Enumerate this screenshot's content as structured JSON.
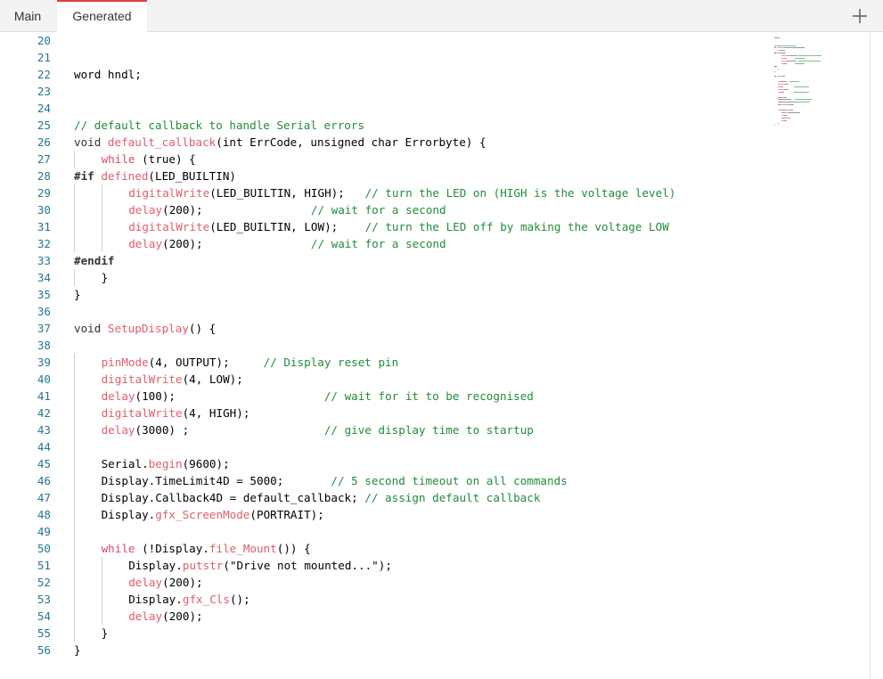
{
  "tabs": [
    {
      "label": "Main"
    },
    {
      "label": "Generated"
    }
  ],
  "add_tab_icon": "plus-icon",
  "colors": {
    "comment": "#218c3a",
    "function": "#e15d6b",
    "line_number": "#237893",
    "active_tab_accent": "#e04040"
  },
  "editor": {
    "lines": [
      {
        "n": "20",
        "indent": 0,
        "tokens": []
      },
      {
        "n": "21",
        "indent": 0,
        "tokens": []
      },
      {
        "n": "22",
        "indent": 0,
        "tokens": [
          {
            "t": "word hndl;",
            "c": ""
          }
        ]
      },
      {
        "n": "23",
        "indent": 0,
        "tokens": []
      },
      {
        "n": "24",
        "indent": 0,
        "tokens": []
      },
      {
        "n": "25",
        "indent": 0,
        "tokens": [
          {
            "t": "// default callback to handle Serial errors",
            "c": "cm"
          }
        ]
      },
      {
        "n": "26",
        "indent": 0,
        "tokens": [
          {
            "t": "void ",
            "c": "kw"
          },
          {
            "t": "default_callback",
            "c": "fn"
          },
          {
            "t": "(int ErrCode, unsigned char Errorbyte) {",
            "c": ""
          }
        ]
      },
      {
        "n": "27",
        "indent": 1,
        "tokens": [
          {
            "t": "while",
            "c": "ctrl"
          },
          {
            "t": " (true) {",
            "c": ""
          }
        ]
      },
      {
        "n": "28",
        "indent": 0,
        "tokens": [
          {
            "t": "#if",
            "c": "pp"
          },
          {
            "t": " ",
            "c": ""
          },
          {
            "t": "defined",
            "c": "fn"
          },
          {
            "t": "(LED_BUILTIN)",
            "c": ""
          }
        ]
      },
      {
        "n": "29",
        "indent": 2,
        "tokens": [
          {
            "t": "digitalWrite",
            "c": "fn"
          },
          {
            "t": "(LED_BUILTIN, HIGH);   ",
            "c": ""
          },
          {
            "t": "// turn the LED on (HIGH is the voltage level)",
            "c": "cm"
          }
        ]
      },
      {
        "n": "30",
        "indent": 2,
        "tokens": [
          {
            "t": "delay",
            "c": "fn"
          },
          {
            "t": "(200);                ",
            "c": ""
          },
          {
            "t": "// wait for a second",
            "c": "cm"
          }
        ]
      },
      {
        "n": "31",
        "indent": 2,
        "tokens": [
          {
            "t": "digitalWrite",
            "c": "fn"
          },
          {
            "t": "(LED_BUILTIN, LOW);    ",
            "c": ""
          },
          {
            "t": "// turn the LED off by making the voltage LOW",
            "c": "cm"
          }
        ]
      },
      {
        "n": "32",
        "indent": 2,
        "tokens": [
          {
            "t": "delay",
            "c": "fn"
          },
          {
            "t": "(200);                ",
            "c": ""
          },
          {
            "t": "// wait for a second",
            "c": "cm"
          }
        ]
      },
      {
        "n": "33",
        "indent": 0,
        "tokens": [
          {
            "t": "#endif",
            "c": "pp"
          }
        ]
      },
      {
        "n": "34",
        "indent": 1,
        "tokens": [
          {
            "t": "}",
            "c": ""
          }
        ]
      },
      {
        "n": "35",
        "indent": 0,
        "tokens": [
          {
            "t": "}",
            "c": ""
          }
        ]
      },
      {
        "n": "36",
        "indent": 0,
        "tokens": []
      },
      {
        "n": "37",
        "indent": 0,
        "tokens": [
          {
            "t": "void ",
            "c": "kw"
          },
          {
            "t": "SetupDisplay",
            "c": "fn"
          },
          {
            "t": "() {",
            "c": ""
          }
        ]
      },
      {
        "n": "38",
        "indent": 0,
        "tokens": []
      },
      {
        "n": "39",
        "indent": 1,
        "tokens": [
          {
            "t": "pinMode",
            "c": "fn"
          },
          {
            "t": "(4, OUTPUT);     ",
            "c": ""
          },
          {
            "t": "// Display reset pin",
            "c": "cm"
          }
        ]
      },
      {
        "n": "40",
        "indent": 1,
        "tokens": [
          {
            "t": "digitalWrite",
            "c": "fn"
          },
          {
            "t": "(4, LOW);",
            "c": ""
          }
        ]
      },
      {
        "n": "41",
        "indent": 1,
        "tokens": [
          {
            "t": "delay",
            "c": "fn"
          },
          {
            "t": "(100);                      ",
            "c": ""
          },
          {
            "t": "// wait for it to be recognised",
            "c": "cm"
          }
        ]
      },
      {
        "n": "42",
        "indent": 1,
        "tokens": [
          {
            "t": "digitalWrite",
            "c": "fn"
          },
          {
            "t": "(4, HIGH);",
            "c": ""
          }
        ]
      },
      {
        "n": "43",
        "indent": 1,
        "tokens": [
          {
            "t": "delay",
            "c": "fn"
          },
          {
            "t": "(3000) ;                    ",
            "c": ""
          },
          {
            "t": "// give display time to startup",
            "c": "cm"
          }
        ]
      },
      {
        "n": "44",
        "indent": 1,
        "tokens": []
      },
      {
        "n": "45",
        "indent": 1,
        "tokens": [
          {
            "t": "Serial.",
            "c": ""
          },
          {
            "t": "begin",
            "c": "fn"
          },
          {
            "t": "(9600);",
            "c": ""
          }
        ]
      },
      {
        "n": "46",
        "indent": 1,
        "tokens": [
          {
            "t": "Display.TimeLimit4D = 5000;       ",
            "c": ""
          },
          {
            "t": "// 5 second timeout on all commands",
            "c": "cm"
          }
        ]
      },
      {
        "n": "47",
        "indent": 1,
        "tokens": [
          {
            "t": "Display.Callback4D = default_callback; ",
            "c": ""
          },
          {
            "t": "// assign default callback",
            "c": "cm"
          }
        ]
      },
      {
        "n": "48",
        "indent": 1,
        "tokens": [
          {
            "t": "Display.",
            "c": ""
          },
          {
            "t": "gfx_ScreenMode",
            "c": "fn"
          },
          {
            "t": "(PORTRAIT);",
            "c": ""
          }
        ]
      },
      {
        "n": "49",
        "indent": 1,
        "tokens": []
      },
      {
        "n": "50",
        "indent": 1,
        "tokens": [
          {
            "t": "while",
            "c": "ctrl"
          },
          {
            "t": " (!Display.",
            "c": ""
          },
          {
            "t": "file_Mount",
            "c": "fn"
          },
          {
            "t": "()) {",
            "c": ""
          }
        ]
      },
      {
        "n": "51",
        "indent": 2,
        "tokens": [
          {
            "t": "Display.",
            "c": ""
          },
          {
            "t": "putstr",
            "c": "fn"
          },
          {
            "t": "(\"Drive not mounted...\");",
            "c": ""
          }
        ]
      },
      {
        "n": "52",
        "indent": 2,
        "tokens": [
          {
            "t": "delay",
            "c": "fn"
          },
          {
            "t": "(200);",
            "c": ""
          }
        ]
      },
      {
        "n": "53",
        "indent": 2,
        "tokens": [
          {
            "t": "Display.",
            "c": ""
          },
          {
            "t": "gfx_Cls",
            "c": "fn"
          },
          {
            "t": "();",
            "c": ""
          }
        ]
      },
      {
        "n": "54",
        "indent": 2,
        "tokens": [
          {
            "t": "delay",
            "c": "fn"
          },
          {
            "t": "(200);",
            "c": ""
          }
        ]
      },
      {
        "n": "55",
        "indent": 1,
        "tokens": [
          {
            "t": "}",
            "c": ""
          }
        ]
      },
      {
        "n": "56",
        "indent": 0,
        "tokens": [
          {
            "t": "}",
            "c": ""
          }
        ]
      }
    ]
  }
}
